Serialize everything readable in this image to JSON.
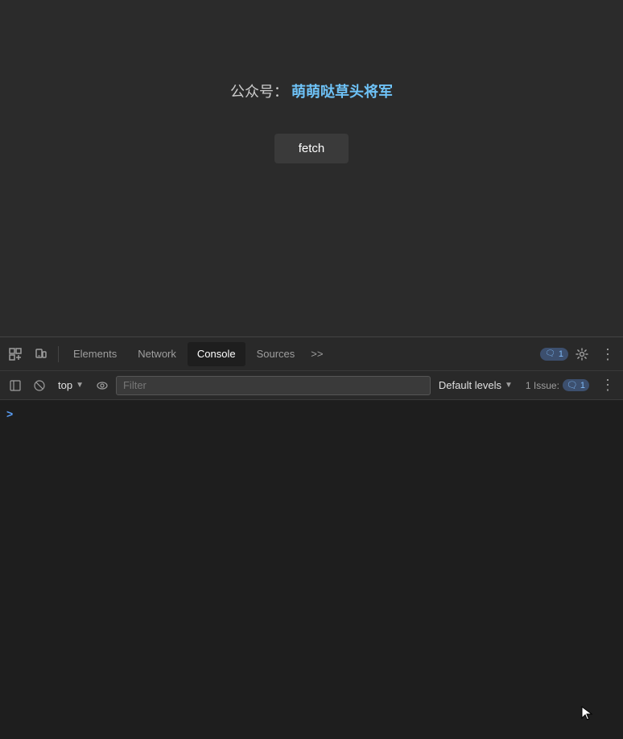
{
  "page": {
    "background_color": "#2b2b2b"
  },
  "content": {
    "title_label": "公众号：",
    "title_highlight": "萌萌哒草头将军",
    "fetch_button_label": "fetch"
  },
  "devtools": {
    "tabs": [
      {
        "id": "elements",
        "label": "Elements",
        "active": false
      },
      {
        "id": "network",
        "label": "Network",
        "active": false
      },
      {
        "id": "console",
        "label": "Console",
        "active": true
      },
      {
        "id": "sources",
        "label": "Sources",
        "active": false
      },
      {
        "id": "more",
        "label": ">>",
        "active": false
      }
    ],
    "badge_count": "1",
    "badge_icon": "🗨",
    "settings_icon": "⚙",
    "more_icon": "⋮"
  },
  "console_toolbar": {
    "top_label": "top",
    "filter_placeholder": "Filter",
    "default_levels_label": "Default levels",
    "issue_prefix": "1 Issue:",
    "issue_count": "1",
    "issue_icon": "🗨"
  },
  "console_output": {
    "prompt_symbol": ">"
  }
}
